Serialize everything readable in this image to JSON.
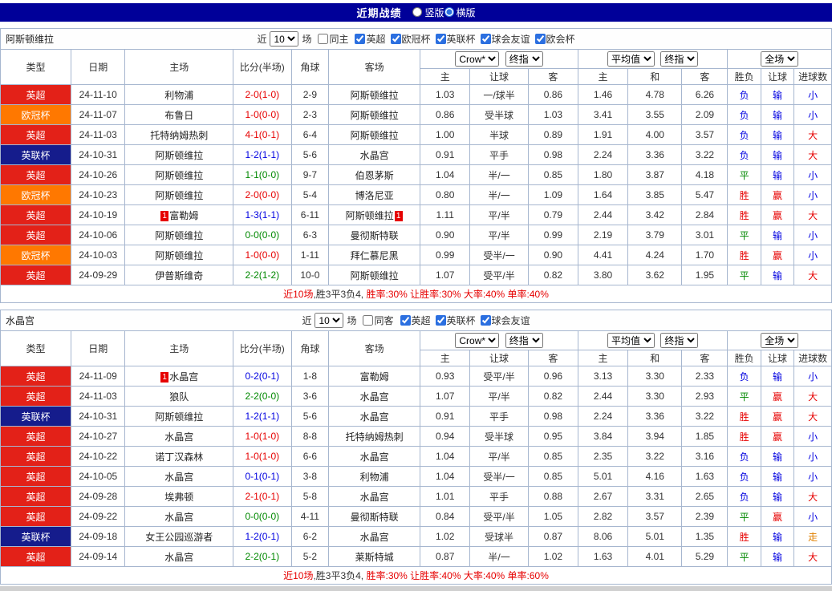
{
  "top_bar": {
    "title": "近期战绩",
    "layout_options": [
      {
        "label": "竖版",
        "selected": false
      },
      {
        "label": "横版",
        "selected": true
      }
    ]
  },
  "table_headers": {
    "type": "类型",
    "date": "日期",
    "home": "主场",
    "score": "比分(半场)",
    "corner": "角球",
    "away": "客场",
    "odds_home": "主",
    "odds_handicap": "让球",
    "odds_away": "客",
    "euro_home": "主",
    "euro_draw": "和",
    "euro_away": "客",
    "result_wl": "胜负",
    "result_handicap": "让球",
    "result_goals": "进球数"
  },
  "colors": {
    "header_bar": "#000099",
    "league_epl": "#e32118",
    "league_ucl": "#ff7800",
    "league_efl_cup": "#151c8c",
    "win_red": "#e60000",
    "draw_green": "#008800",
    "loss_blue": "#0000e0",
    "void_orange": "#e08000",
    "focus_team_green": "#008800",
    "table_border": "#a6b6cf"
  },
  "sections": [
    {
      "team": "阿斯顿维拉",
      "filter": {
        "prefix": "近",
        "count": "10",
        "suffix": "场",
        "same_venue": {
          "label": "同主",
          "checked": false
        },
        "leagues": [
          {
            "label": "英超",
            "checked": true
          },
          {
            "label": "欧冠杯",
            "checked": true
          },
          {
            "label": "英联杯",
            "checked": true
          },
          {
            "label": "球会友谊",
            "checked": true
          },
          {
            "label": "欧会杯",
            "checked": true
          }
        ]
      },
      "dropdowns": {
        "source": "Crow*",
        "source_mode": "终指",
        "avg": "平均值",
        "avg_mode": "终指",
        "scope": "全场"
      },
      "rows": [
        {
          "league": "英超",
          "league_color": "red",
          "date": "24-11-10",
          "home": "利物浦",
          "home_green": false,
          "home_badge": "",
          "score": "2-0(1-0)",
          "score_color": "red",
          "corner": "2-9",
          "away": "阿斯顿维拉",
          "away_green": true,
          "away_badge": "",
          "asian": [
            "1.03",
            "一/球半",
            "0.86"
          ],
          "euro": [
            "1.46",
            "4.78",
            "6.26"
          ],
          "results": [
            [
              "负",
              "blue"
            ],
            [
              "输",
              "blue"
            ],
            [
              "小",
              "blue"
            ]
          ]
        },
        {
          "league": "欧冠杯",
          "league_color": "orange",
          "date": "24-11-07",
          "home": "布鲁日",
          "home_green": false,
          "home_badge": "",
          "score": "1-0(0-0)",
          "score_color": "red",
          "corner": "2-3",
          "away": "阿斯顿维拉",
          "away_green": true,
          "away_badge": "",
          "asian": [
            "0.86",
            "受半球",
            "1.03"
          ],
          "euro": [
            "3.41",
            "3.55",
            "2.09"
          ],
          "results": [
            [
              "负",
              "blue"
            ],
            [
              "输",
              "blue"
            ],
            [
              "小",
              "blue"
            ]
          ]
        },
        {
          "league": "英超",
          "league_color": "red",
          "date": "24-11-03",
          "home": "托特纳姆热刺",
          "home_green": false,
          "home_badge": "",
          "score": "4-1(0-1)",
          "score_color": "red",
          "corner": "6-4",
          "away": "阿斯顿维拉",
          "away_green": true,
          "away_badge": "",
          "asian": [
            "1.00",
            "半球",
            "0.89"
          ],
          "euro": [
            "1.91",
            "4.00",
            "3.57"
          ],
          "results": [
            [
              "负",
              "blue"
            ],
            [
              "输",
              "blue"
            ],
            [
              "大",
              "red"
            ]
          ]
        },
        {
          "league": "英联杯",
          "league_color": "navy",
          "date": "24-10-31",
          "home": "阿斯顿维拉",
          "home_green": true,
          "home_badge": "",
          "score": "1-2(1-1)",
          "score_color": "blue",
          "corner": "5-6",
          "away": "水晶宫",
          "away_green": false,
          "away_badge": "",
          "asian": [
            "0.91",
            "平手",
            "0.98"
          ],
          "euro": [
            "2.24",
            "3.36",
            "3.22"
          ],
          "results": [
            [
              "负",
              "blue"
            ],
            [
              "输",
              "blue"
            ],
            [
              "大",
              "red"
            ]
          ]
        },
        {
          "league": "英超",
          "league_color": "red",
          "date": "24-10-26",
          "home": "阿斯顿维拉",
          "home_green": true,
          "home_badge": "",
          "score": "1-1(0-0)",
          "score_color": "green",
          "corner": "9-7",
          "away": "伯恩茅斯",
          "away_green": false,
          "away_badge": "",
          "asian": [
            "1.04",
            "半/一",
            "0.85"
          ],
          "euro": [
            "1.80",
            "3.87",
            "4.18"
          ],
          "results": [
            [
              "平",
              "green"
            ],
            [
              "输",
              "blue"
            ],
            [
              "小",
              "blue"
            ]
          ]
        },
        {
          "league": "欧冠杯",
          "league_color": "orange",
          "date": "24-10-23",
          "home": "阿斯顿维拉",
          "home_green": true,
          "home_badge": "",
          "score": "2-0(0-0)",
          "score_color": "red",
          "corner": "5-4",
          "away": "博洛尼亚",
          "away_green": false,
          "away_badge": "",
          "asian": [
            "0.80",
            "半/一",
            "1.09"
          ],
          "euro": [
            "1.64",
            "3.85",
            "5.47"
          ],
          "results": [
            [
              "胜",
              "red"
            ],
            [
              "赢",
              "red"
            ],
            [
              "小",
              "blue"
            ]
          ]
        },
        {
          "league": "英超",
          "league_color": "red",
          "date": "24-10-19",
          "home": "富勒姆",
          "home_green": false,
          "home_badge": "1",
          "score": "1-3(1-1)",
          "score_color": "blue",
          "corner": "6-11",
          "away": "阿斯顿维拉",
          "away_green": true,
          "away_badge": "1",
          "asian": [
            "1.11",
            "平/半",
            "0.79"
          ],
          "euro": [
            "2.44",
            "3.42",
            "2.84"
          ],
          "results": [
            [
              "胜",
              "red"
            ],
            [
              "赢",
              "red"
            ],
            [
              "大",
              "red"
            ]
          ]
        },
        {
          "league": "英超",
          "league_color": "red",
          "date": "24-10-06",
          "home": "阿斯顿维拉",
          "home_green": true,
          "home_badge": "",
          "score": "0-0(0-0)",
          "score_color": "green",
          "corner": "6-3",
          "away": "曼彻斯特联",
          "away_green": false,
          "away_badge": "",
          "asian": [
            "0.90",
            "平/半",
            "0.99"
          ],
          "euro": [
            "2.19",
            "3.79",
            "3.01"
          ],
          "results": [
            [
              "平",
              "green"
            ],
            [
              "输",
              "blue"
            ],
            [
              "小",
              "blue"
            ]
          ]
        },
        {
          "league": "欧冠杯",
          "league_color": "orange",
          "date": "24-10-03",
          "home": "阿斯顿维拉",
          "home_green": true,
          "home_badge": "",
          "score": "1-0(0-0)",
          "score_color": "red",
          "corner": "1-11",
          "away": "拜仁慕尼黑",
          "away_green": false,
          "away_badge": "",
          "asian": [
            "0.99",
            "受半/一",
            "0.90"
          ],
          "euro": [
            "4.41",
            "4.24",
            "1.70"
          ],
          "results": [
            [
              "胜",
              "red"
            ],
            [
              "赢",
              "red"
            ],
            [
              "小",
              "blue"
            ]
          ]
        },
        {
          "league": "英超",
          "league_color": "red",
          "date": "24-09-29",
          "home": "伊普斯维奇",
          "home_green": false,
          "home_badge": "",
          "score": "2-2(1-2)",
          "score_color": "green",
          "corner": "10-0",
          "away": "阿斯顿维拉",
          "away_green": true,
          "away_badge": "",
          "asian": [
            "1.07",
            "受平/半",
            "0.82"
          ],
          "euro": [
            "3.80",
            "3.62",
            "1.95"
          ],
          "results": [
            [
              "平",
              "green"
            ],
            [
              "输",
              "blue"
            ],
            [
              "大",
              "red"
            ]
          ]
        }
      ],
      "summary": [
        {
          "text": "近10场",
          "color": "red"
        },
        {
          "text": ",胜3平3负4, ",
          "color": "dark"
        },
        {
          "text": "胜率:30%",
          "color": "red"
        },
        {
          "text": " 让胜率:30%",
          "color": "red"
        },
        {
          "text": " 大率:40%",
          "color": "red"
        },
        {
          "text": " 单率:40%",
          "color": "red"
        }
      ]
    },
    {
      "team": "水晶宫",
      "filter": {
        "prefix": "近",
        "count": "10",
        "suffix": "场",
        "same_venue": {
          "label": "同客",
          "checked": false
        },
        "leagues": [
          {
            "label": "英超",
            "checked": true
          },
          {
            "label": "英联杯",
            "checked": true
          },
          {
            "label": "球会友谊",
            "checked": true
          }
        ]
      },
      "dropdowns": {
        "source": "Crow*",
        "source_mode": "终指",
        "avg": "平均值",
        "avg_mode": "终指",
        "scope": "全场"
      },
      "rows": [
        {
          "league": "英超",
          "league_color": "red",
          "date": "24-11-09",
          "home": "水晶宫",
          "home_green": true,
          "home_badge": "1",
          "score": "0-2(0-1)",
          "score_color": "blue",
          "corner": "1-8",
          "away": "富勒姆",
          "away_green": false,
          "away_badge": "",
          "asian": [
            "0.93",
            "受平/半",
            "0.96"
          ],
          "euro": [
            "3.13",
            "3.30",
            "2.33"
          ],
          "results": [
            [
              "负",
              "blue"
            ],
            [
              "输",
              "blue"
            ],
            [
              "小",
              "blue"
            ]
          ]
        },
        {
          "league": "英超",
          "league_color": "red",
          "date": "24-11-03",
          "home": "狼队",
          "home_green": false,
          "home_badge": "",
          "score": "2-2(0-0)",
          "score_color": "green",
          "corner": "3-6",
          "away": "水晶宫",
          "away_green": true,
          "away_badge": "",
          "asian": [
            "1.07",
            "平/半",
            "0.82"
          ],
          "euro": [
            "2.44",
            "3.30",
            "2.93"
          ],
          "results": [
            [
              "平",
              "green"
            ],
            [
              "赢",
              "red"
            ],
            [
              "大",
              "red"
            ]
          ]
        },
        {
          "league": "英联杯",
          "league_color": "navy",
          "date": "24-10-31",
          "home": "阿斯顿维拉",
          "home_green": false,
          "home_badge": "",
          "score": "1-2(1-1)",
          "score_color": "blue",
          "corner": "5-6",
          "away": "水晶宫",
          "away_green": true,
          "away_badge": "",
          "asian": [
            "0.91",
            "平手",
            "0.98"
          ],
          "euro": [
            "2.24",
            "3.36",
            "3.22"
          ],
          "results": [
            [
              "胜",
              "red"
            ],
            [
              "赢",
              "red"
            ],
            [
              "大",
              "red"
            ]
          ]
        },
        {
          "league": "英超",
          "league_color": "red",
          "date": "24-10-27",
          "home": "水晶宫",
          "home_green": true,
          "home_badge": "",
          "score": "1-0(1-0)",
          "score_color": "red",
          "corner": "8-8",
          "away": "托特纳姆热刺",
          "away_green": false,
          "away_badge": "",
          "asian": [
            "0.94",
            "受半球",
            "0.95"
          ],
          "euro": [
            "3.84",
            "3.94",
            "1.85"
          ],
          "results": [
            [
              "胜",
              "red"
            ],
            [
              "赢",
              "red"
            ],
            [
              "小",
              "blue"
            ]
          ]
        },
        {
          "league": "英超",
          "league_color": "red",
          "date": "24-10-22",
          "home": "诺丁汉森林",
          "home_green": false,
          "home_badge": "",
          "score": "1-0(1-0)",
          "score_color": "red",
          "corner": "6-6",
          "away": "水晶宫",
          "away_green": true,
          "away_badge": "",
          "asian": [
            "1.04",
            "平/半",
            "0.85"
          ],
          "euro": [
            "2.35",
            "3.22",
            "3.16"
          ],
          "results": [
            [
              "负",
              "blue"
            ],
            [
              "输",
              "blue"
            ],
            [
              "小",
              "blue"
            ]
          ]
        },
        {
          "league": "英超",
          "league_color": "red",
          "date": "24-10-05",
          "home": "水晶宫",
          "home_green": true,
          "home_badge": "",
          "score": "0-1(0-1)",
          "score_color": "blue",
          "corner": "3-8",
          "away": "利物浦",
          "away_green": false,
          "away_badge": "",
          "asian": [
            "1.04",
            "受半/一",
            "0.85"
          ],
          "euro": [
            "5.01",
            "4.16",
            "1.63"
          ],
          "results": [
            [
              "负",
              "blue"
            ],
            [
              "输",
              "blue"
            ],
            [
              "小",
              "blue"
            ]
          ]
        },
        {
          "league": "英超",
          "league_color": "red",
          "date": "24-09-28",
          "home": "埃弗顿",
          "home_green": false,
          "home_badge": "",
          "score": "2-1(0-1)",
          "score_color": "red",
          "corner": "5-8",
          "away": "水晶宫",
          "away_green": true,
          "away_badge": "",
          "asian": [
            "1.01",
            "平手",
            "0.88"
          ],
          "euro": [
            "2.67",
            "3.31",
            "2.65"
          ],
          "results": [
            [
              "负",
              "blue"
            ],
            [
              "输",
              "blue"
            ],
            [
              "大",
              "red"
            ]
          ]
        },
        {
          "league": "英超",
          "league_color": "red",
          "date": "24-09-22",
          "home": "水晶宫",
          "home_green": true,
          "home_badge": "",
          "score": "0-0(0-0)",
          "score_color": "green",
          "corner": "4-11",
          "away": "曼彻斯特联",
          "away_green": false,
          "away_badge": "",
          "asian": [
            "0.84",
            "受平/半",
            "1.05"
          ],
          "euro": [
            "2.82",
            "3.57",
            "2.39"
          ],
          "results": [
            [
              "平",
              "green"
            ],
            [
              "赢",
              "red"
            ],
            [
              "小",
              "blue"
            ]
          ]
        },
        {
          "league": "英联杯",
          "league_color": "navy",
          "date": "24-09-18",
          "home": "女王公园巡游者",
          "home_green": false,
          "home_badge": "",
          "score": "1-2(0-1)",
          "score_color": "blue",
          "corner": "6-2",
          "away": "水晶宫",
          "away_green": true,
          "away_badge": "",
          "asian": [
            "1.02",
            "受球半",
            "0.87"
          ],
          "euro": [
            "8.06",
            "5.01",
            "1.35"
          ],
          "results": [
            [
              "胜",
              "red"
            ],
            [
              "输",
              "blue"
            ],
            [
              "走",
              "orange"
            ]
          ]
        },
        {
          "league": "英超",
          "league_color": "red",
          "date": "24-09-14",
          "home": "水晶宫",
          "home_green": true,
          "home_badge": "",
          "score": "2-2(0-1)",
          "score_color": "green",
          "corner": "5-2",
          "away": "莱斯特城",
          "away_green": false,
          "away_badge": "",
          "asian": [
            "0.87",
            "半/一",
            "1.02"
          ],
          "euro": [
            "1.63",
            "4.01",
            "5.29"
          ],
          "results": [
            [
              "平",
              "green"
            ],
            [
              "输",
              "blue"
            ],
            [
              "大",
              "red"
            ]
          ]
        }
      ],
      "summary": [
        {
          "text": "近10场",
          "color": "red"
        },
        {
          "text": ",胜3平3负4, ",
          "color": "dark"
        },
        {
          "text": "胜率:30%",
          "color": "red"
        },
        {
          "text": " 让胜率:40%",
          "color": "red"
        },
        {
          "text": " 大率:40%",
          "color": "red"
        },
        {
          "text": " 单率:60%",
          "color": "red"
        }
      ]
    }
  ]
}
